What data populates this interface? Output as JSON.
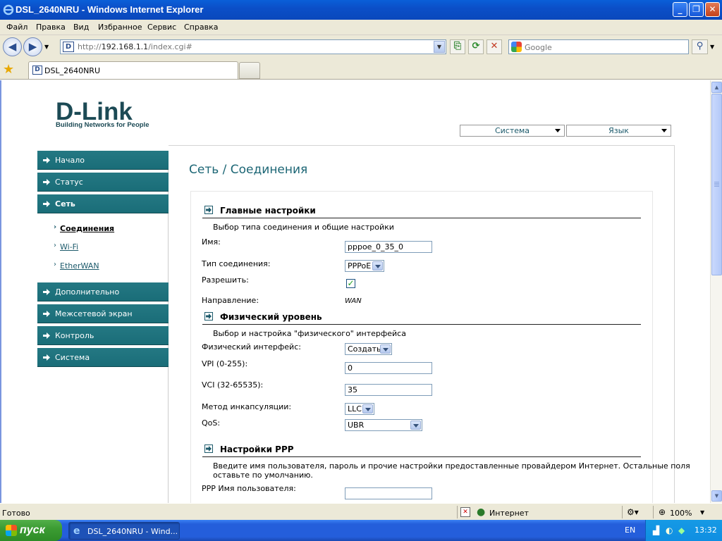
{
  "window": {
    "title": "DSL_2640NRU - Windows Internet Explorer"
  },
  "menubar": [
    "Файл",
    "Правка",
    "Вид",
    "Избранное",
    "Сервис",
    "Справка"
  ],
  "address": {
    "url_prefix": "http://",
    "url_host": "192.168.1.1",
    "url_path": "/index.cgi#"
  },
  "search": {
    "placeholder": "Google"
  },
  "tab": {
    "label": "DSL_2640NRU"
  },
  "header": {
    "logo": "D-Link",
    "tagline": "Building Networks for People",
    "system_select": "Система",
    "language_select": "Язык"
  },
  "sidebar": {
    "items": [
      "Начало",
      "Статус",
      "Сеть",
      "Дополнительно",
      "Межсетевой экран",
      "Контроль",
      "Система"
    ],
    "subitems": [
      "Соединения",
      "Wi-Fi",
      "EtherWAN"
    ]
  },
  "page": {
    "title": "Сеть / Соединения"
  },
  "main_section": {
    "title": "Главные настройки",
    "description": "Выбор типа соединения и общие настройки",
    "name_label": "Имя:",
    "name_value": "pppoe_0_35_0",
    "type_label": "Тип соединения:",
    "type_value": "PPPoE",
    "enable_label": "Разрешить:",
    "direction_label": "Направление:",
    "direction_value": "WAN"
  },
  "phys_section": {
    "title": "Физический уровень",
    "description": "Выбор и настройка \"физического\" интерфейса",
    "iface_label": "Физический интерфейс:",
    "iface_value": "Создать",
    "vpi_label": "VPI (0-255):",
    "vpi_value": "0",
    "vci_label": "VCI (32-65535):",
    "vci_value": "35",
    "encap_label": "Метод инкапсуляции:",
    "encap_value": "LLC",
    "qos_label": "QoS:",
    "qos_value": "UBR"
  },
  "ppp_section": {
    "title": "Настройки PPP",
    "description_line1": "Введите имя пользователя, пароль и прочие настройки предоставленные провайдером Интернет. Остальные поля",
    "description_line2": "оставьте по умолчанию.",
    "user_label": "PPP Имя пользователя:",
    "user_value": ""
  },
  "statusbar": {
    "status": "Готово",
    "zone": "Интернет",
    "zoom": "100%"
  },
  "taskbar": {
    "start": "пуск",
    "task_item": "DSL_2640NRU - Wind...",
    "lang": "EN",
    "clock": "13:32"
  },
  "colors": {
    "accent": "#1c6d78",
    "title_blue": "#1c6675"
  }
}
